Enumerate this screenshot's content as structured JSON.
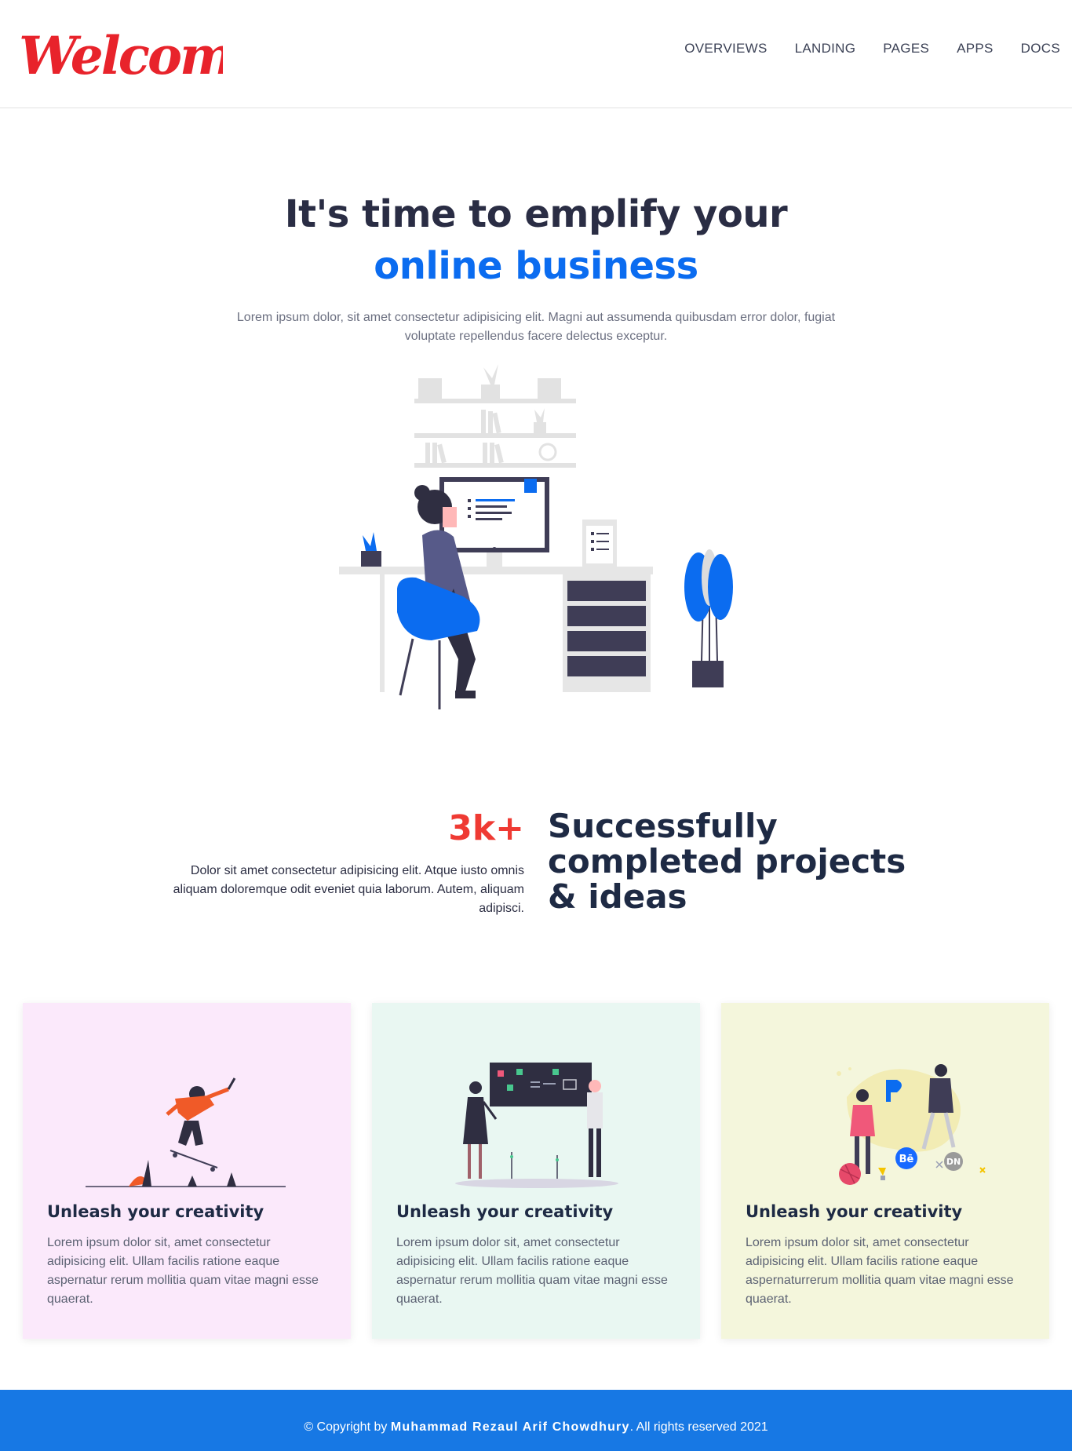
{
  "header": {
    "logo_text": "Welcome",
    "nav": [
      {
        "label": "OVERVIEWS"
      },
      {
        "label": "LANDING"
      },
      {
        "label": "PAGES"
      },
      {
        "label": "APPS"
      },
      {
        "label": "DOCS"
      }
    ]
  },
  "hero": {
    "title_line1": "It's time to emplify your",
    "title_line2": "online business",
    "description": "Lorem ipsum dolor, sit amet consectetur adipisicing elit. Magni aut assumenda quibusdam error dolor, fugiat voluptate repellendus facere delectus exceptur."
  },
  "stats": {
    "number": "3k+",
    "description": "Dolor sit amet consectetur adipisicing elit. Atque iusto omnis aliquam doloremque odit eveniet quia laborum. Autem, aliquam adipisci.",
    "heading": "Successfully completed projects & ideas"
  },
  "cards": [
    {
      "title": "Unleash your creativity",
      "body": "Lorem ipsum dolor sit, amet consectetur adipisicing elit. Ullam facilis ratione eaque aspernatur rerum mollitia quam vitae magni esse quaerat."
    },
    {
      "title": "Unleash your creativity",
      "body": "Lorem ipsum dolor sit, amet consectetur adipisicing elit. Ullam facilis ratione eaque aspernatur rerum mollitia quam vitae magni esse quaerat."
    },
    {
      "title": "Unleash your creativity",
      "body": "Lorem ipsum dolor sit, amet consectetur adipisicing elit. Ullam facilis ratione eaque aspernaturrerum mollitia quam vitae magni esse quaerat."
    }
  ],
  "card_icons": {
    "behance": "Bē",
    "dribbble_next": "DN"
  },
  "footer": {
    "prefix": "© Copyright by ",
    "author": "Muhammad Rezaul Arif Chowdhury",
    "suffix": ". All rights reserved 2021"
  },
  "colors": {
    "accent_blue": "#0b6cf0",
    "logo_red": "#e8232b",
    "stat_red": "#ef3a33",
    "footer_blue": "#1778e4",
    "card_pink": "#fbe9fb",
    "card_mint": "#e9f7f2",
    "card_yellow": "#f4f6dc"
  }
}
